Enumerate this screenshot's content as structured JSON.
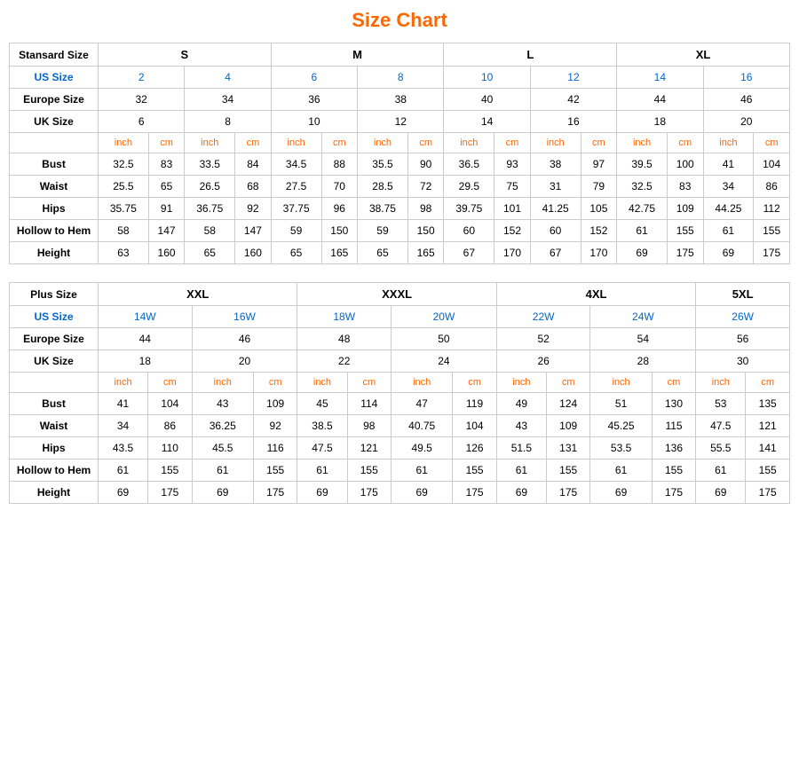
{
  "title": "Size Chart",
  "standard": {
    "header_label": "Stansard Size",
    "size_groups": [
      "S",
      "M",
      "L",
      "XL"
    ],
    "us_size_label": "US Size",
    "europe_size_label": "Europe Size",
    "uk_size_label": "UK Size",
    "us_sizes": [
      "2",
      "4",
      "6",
      "8",
      "10",
      "12",
      "14",
      "16"
    ],
    "europe_sizes": [
      "32",
      "34",
      "36",
      "38",
      "40",
      "42",
      "44",
      "46"
    ],
    "uk_sizes": [
      "6",
      "8",
      "10",
      "12",
      "14",
      "16",
      "18",
      "20"
    ],
    "unit_inch": "inch",
    "unit_cm": "cm",
    "measurements": [
      {
        "label": "Bust",
        "values": [
          "32.5",
          "83",
          "33.5",
          "84",
          "34.5",
          "88",
          "35.5",
          "90",
          "36.5",
          "93",
          "38",
          "97",
          "39.5",
          "100",
          "41",
          "104"
        ]
      },
      {
        "label": "Waist",
        "values": [
          "25.5",
          "65",
          "26.5",
          "68",
          "27.5",
          "70",
          "28.5",
          "72",
          "29.5",
          "75",
          "31",
          "79",
          "32.5",
          "83",
          "34",
          "86"
        ]
      },
      {
        "label": "Hips",
        "values": [
          "35.75",
          "91",
          "36.75",
          "92",
          "37.75",
          "96",
          "38.75",
          "98",
          "39.75",
          "101",
          "41.25",
          "105",
          "42.75",
          "109",
          "44.25",
          "112"
        ]
      },
      {
        "label": "Hollow to Hem",
        "values": [
          "58",
          "147",
          "58",
          "147",
          "59",
          "150",
          "59",
          "150",
          "60",
          "152",
          "60",
          "152",
          "61",
          "155",
          "61",
          "155"
        ]
      },
      {
        "label": "Height",
        "values": [
          "63",
          "160",
          "65",
          "160",
          "65",
          "165",
          "65",
          "165",
          "67",
          "170",
          "67",
          "170",
          "69",
          "175",
          "69",
          "175"
        ]
      }
    ]
  },
  "plus": {
    "header_label": "Plus Size",
    "size_groups": [
      "XXL",
      "XXXL",
      "4XL",
      "5XL"
    ],
    "us_size_label": "US Size",
    "europe_size_label": "Europe Size",
    "uk_size_label": "UK Size",
    "us_sizes": [
      "14W",
      "16W",
      "18W",
      "20W",
      "22W",
      "24W",
      "26W"
    ],
    "europe_sizes": [
      "44",
      "46",
      "48",
      "50",
      "52",
      "54",
      "56"
    ],
    "uk_sizes": [
      "18",
      "20",
      "22",
      "24",
      "26",
      "28",
      "30"
    ],
    "unit_inch": "inch",
    "unit_cm": "cm",
    "measurements": [
      {
        "label": "Bust",
        "values": [
          "41",
          "104",
          "43",
          "109",
          "45",
          "114",
          "47",
          "119",
          "49",
          "124",
          "51",
          "130",
          "53",
          "135"
        ]
      },
      {
        "label": "Waist",
        "values": [
          "34",
          "86",
          "36.25",
          "92",
          "38.5",
          "98",
          "40.75",
          "104",
          "43",
          "109",
          "45.25",
          "115",
          "47.5",
          "121"
        ]
      },
      {
        "label": "Hips",
        "values": [
          "43.5",
          "110",
          "45.5",
          "116",
          "47.5",
          "121",
          "49.5",
          "126",
          "51.5",
          "131",
          "53.5",
          "136",
          "55.5",
          "141"
        ]
      },
      {
        "label": "Hollow to Hem",
        "values": [
          "61",
          "155",
          "61",
          "155",
          "61",
          "155",
          "61",
          "155",
          "61",
          "155",
          "61",
          "155",
          "61",
          "155"
        ]
      },
      {
        "label": "Height",
        "values": [
          "69",
          "175",
          "69",
          "175",
          "69",
          "175",
          "69",
          "175",
          "69",
          "175",
          "69",
          "175",
          "69",
          "175"
        ]
      }
    ]
  }
}
